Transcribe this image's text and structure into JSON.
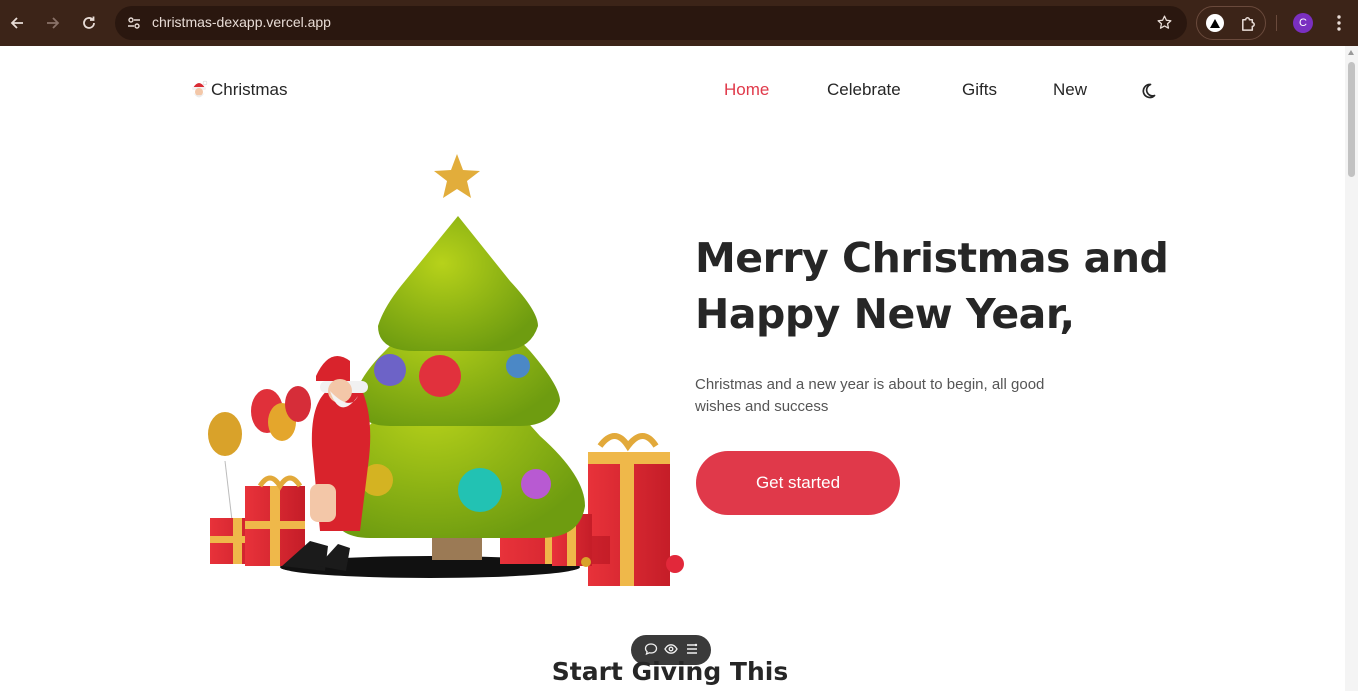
{
  "browser": {
    "url": "christmas-dexapp.vercel.app",
    "profile_initial": "C",
    "icons": [
      "back-icon",
      "forward-icon",
      "reload-icon",
      "site-info-icon",
      "star-icon",
      "vercel-icon",
      "puzzle-icon",
      "kebab-menu-icon"
    ]
  },
  "header": {
    "logo_text": "Christmas",
    "nav": [
      {
        "label": "Home",
        "active": true
      },
      {
        "label": "Celebrate",
        "active": false
      },
      {
        "label": "Gifts",
        "active": false
      },
      {
        "label": "New",
        "active": false
      }
    ],
    "theme_toggle_icon": "moon-icon"
  },
  "hero": {
    "title_line1": "Merry Christmas and",
    "title_line2": "Happy New Year,",
    "description": "Christmas and a new year is about to begin, all good wishes and success",
    "cta_label": "Get started",
    "image": "santa-decorating-christmas-tree-illustration"
  },
  "floating_toolbar": {
    "icons": [
      "comment-icon",
      "eye-icon",
      "menu-lines-icon"
    ]
  },
  "section": {
    "title": "Start Giving This"
  },
  "colors": {
    "accent": "#e0394a",
    "text": "#262626",
    "chrome": "#3c2418"
  }
}
